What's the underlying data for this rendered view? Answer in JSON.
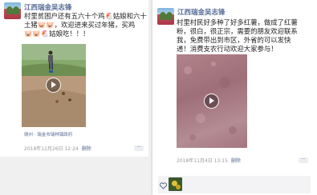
{
  "left_post": {
    "author": "江西瑞金吴志锋",
    "text_lines": [
      "村里贫困户还有五六十个鸡🐔姑娘和六十",
      "土猪🐷🐷，欢迎进来买过年猪，买鸡",
      "🐷🐷🐔姑娘吃！！！"
    ],
    "location": "赣州 · 瑞金市瑞林镇政府",
    "time": "2018年12月26日 12:24",
    "delete_label": "删除",
    "more_label": "··"
  },
  "right_post": {
    "author": "江西瑞金吴志锋",
    "text_lines": [
      "村里村民好多种了好多红薯，做成了红薯",
      "粉，很白，很正宗，需要的朋友欢迎联系",
      "我，免费带出到市区，外省的可以发快",
      "递！消费支农行动欢迎大家参与！"
    ],
    "time": "2018年11月4日 13:15",
    "delete_label": "删除",
    "more_label": "··"
  },
  "colors": {
    "link": "#576b95",
    "meta_gray": "#9a9a9a",
    "text": "#222222"
  }
}
